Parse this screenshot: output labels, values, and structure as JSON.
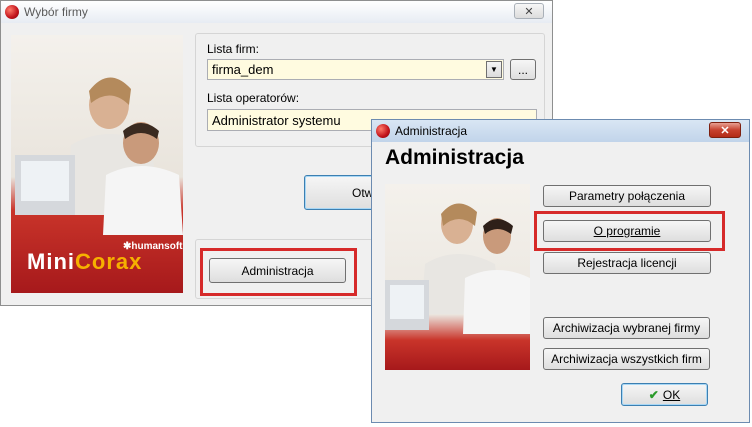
{
  "main_window": {
    "title": "Wybór firmy",
    "close_icon": "close-icon",
    "brand": {
      "name_part1": "Mini",
      "name_part2": "Corax",
      "maker": "humansoft"
    },
    "companies_label": "Lista firm:",
    "company_value": "firma_dem",
    "browse_label": "...",
    "operators_label": "Lista operatorów:",
    "operator_value": "Administrator systemu",
    "open_button_partial": "Otw",
    "admin_button": "Administracja"
  },
  "admin_dialog": {
    "title": "Administracja",
    "heading": "Administracja",
    "buttons": {
      "connection_params": "Parametry połączenia",
      "about": "O programie",
      "license": "Rejestracja licencji",
      "archive_selected": "Archiwizacja wybranej firmy",
      "archive_all": "Archiwizacja wszystkich firm",
      "ok": "OK"
    },
    "ok_icon": "checkmark-icon"
  },
  "colors": {
    "highlight": "#d62a2a",
    "combo_background": "#fffbe0",
    "brand_red": "#c1121b"
  }
}
